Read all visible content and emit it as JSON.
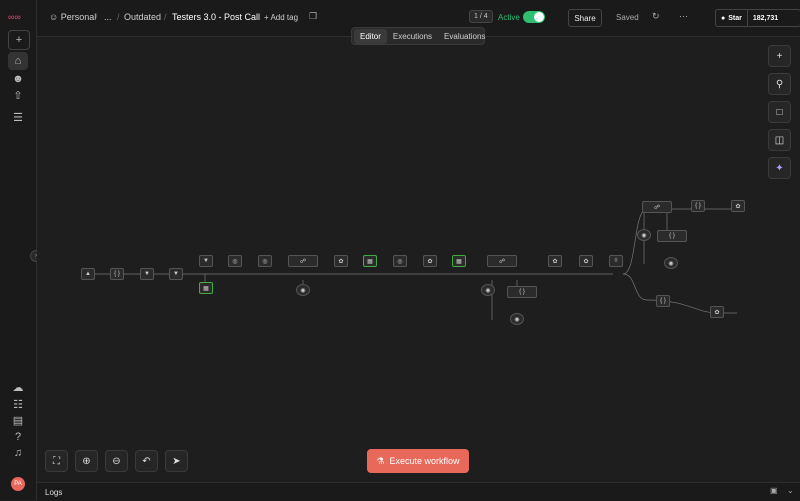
{
  "topbar": {
    "project": "Personal",
    "ellipsis": "...",
    "folder": "Outdated",
    "workflow_name": "Testers 3.0 - Post Call",
    "add_tag": "+ Add tag",
    "pager": "1 / 4",
    "active_label": "Active",
    "share_label": "Share",
    "saved_label": "Saved",
    "more": "⋯",
    "star_label": "Star",
    "star_count": "182,731"
  },
  "tabs": [
    "Editor",
    "Executions",
    "Evaluations"
  ],
  "execute_label": "Execute workflow",
  "logs_label": "Logs",
  "avatar_initials": "PA",
  "colors": {
    "accent": "#e8685a",
    "toggle": "#2fbf71"
  }
}
